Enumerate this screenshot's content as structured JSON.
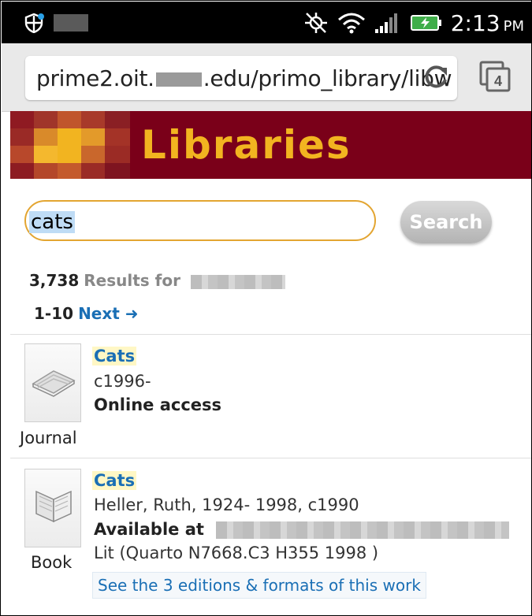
{
  "status_bar": {
    "time": "2:13",
    "ampm": "PM"
  },
  "browser": {
    "url_prefix": "prime2.oit.",
    "url_suffix": ".edu/primo_library/libw",
    "tab_count": "4"
  },
  "banner": {
    "title": "Libraries"
  },
  "search": {
    "value": "cats",
    "button_label": "Search"
  },
  "results": {
    "count": "3,738",
    "label": "Results for",
    "range": "1-10",
    "next_label": "Next ➜"
  },
  "items": [
    {
      "type": "Journal",
      "title": "Cats",
      "line1": "c1996-",
      "line2": "Online access"
    },
    {
      "type": "Book",
      "title": "Cats",
      "line1": "Heller, Ruth, 1924- 1998, c1990",
      "line2": "Available at",
      "line3": "Lit (Quarto N7668.C3 H355 1998 )",
      "editions_link": "See the 3 editions & formats of this work"
    }
  ]
}
